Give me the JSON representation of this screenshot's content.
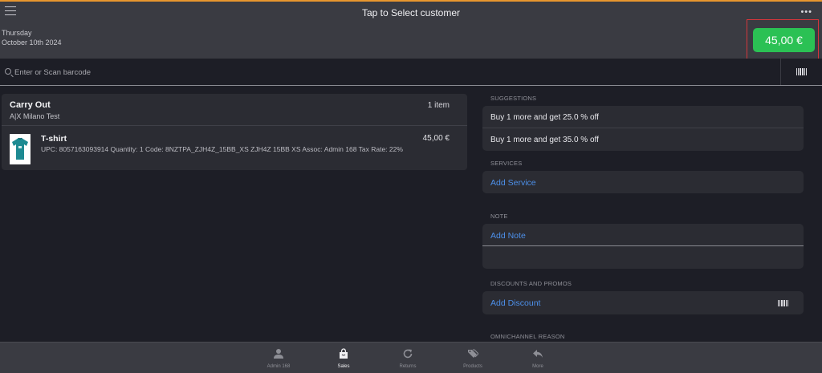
{
  "header": {
    "title": "Tap to Select customer",
    "day": "Thursday",
    "date": "October 10th 2024",
    "total": "45,00 €",
    "menu_icon": "hamburger-icon",
    "more_icon": "ellipsis-icon"
  },
  "search": {
    "placeholder": "Enter or Scan barcode",
    "value": ""
  },
  "cart": {
    "title": "Carry Out",
    "store": "A|X Milano Test",
    "count": "1 item",
    "items": [
      {
        "name": "T-shirt",
        "details": "UPC: 8057163093914 Quantity: 1 Code: 8NZTPA_ZJH4Z_15BB_XS ZJH4Z 15BB XS Assoc: Admin 168 Tax Rate: 22%",
        "price": "45,00 €"
      }
    ]
  },
  "suggestions": {
    "label": "SUGGESTIONS",
    "items": [
      "Buy 1 more and get 25.0 % off",
      "Buy 1 more and get 35.0 % off"
    ]
  },
  "services": {
    "label": "SERVICES",
    "add": "Add Service"
  },
  "note": {
    "label": "NOTE",
    "add": "Add Note"
  },
  "discounts": {
    "label": "DISCOUNTS AND PROMOS",
    "add": "Add Discount"
  },
  "omnichannel": {
    "label": "OMNICHANNEL REASON"
  },
  "tabs": [
    {
      "label": "Admin 168",
      "icon": "person-icon",
      "active": false
    },
    {
      "label": "Sales",
      "icon": "shopping-bag-icon",
      "active": true
    },
    {
      "label": "Returns",
      "icon": "refresh-icon",
      "active": false
    },
    {
      "label": "Products",
      "icon": "tags-icon",
      "active": false
    },
    {
      "label": "More",
      "icon": "reply-icon",
      "active": false
    }
  ],
  "colors": {
    "accent_top": "#e8962e",
    "total_green": "#2bc154",
    "highlight_red": "#d5363b",
    "link_blue": "#4d90ea"
  }
}
